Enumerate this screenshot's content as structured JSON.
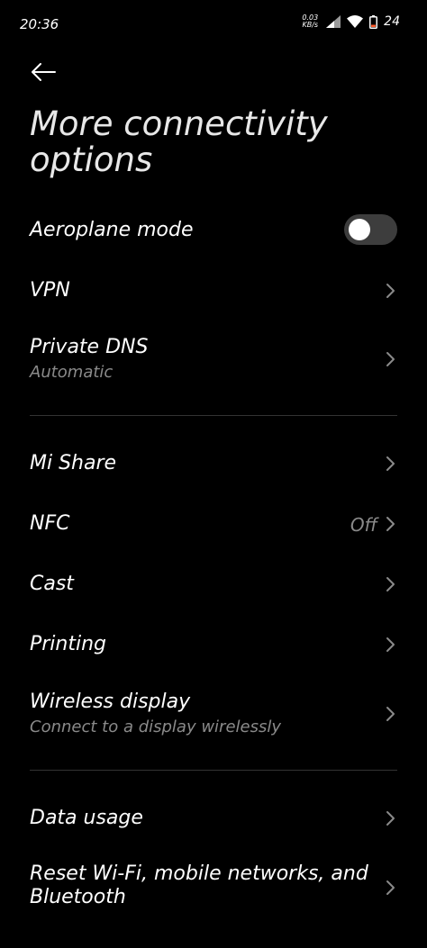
{
  "status_bar": {
    "time": "20:36",
    "net_speed_value": "0.03",
    "net_speed_unit": "KB/s",
    "battery_level": "24",
    "battery_color": "#ff5a2a",
    "icons": [
      "signal-icon",
      "wifi-icon",
      "battery-icon"
    ]
  },
  "header": {
    "back_icon": "arrow-left-icon",
    "title": "More connectivity options"
  },
  "settings": {
    "aeroplane_mode": {
      "label": "Aeroplane mode",
      "toggle_on": false
    },
    "vpn": {
      "label": "VPN"
    },
    "private_dns": {
      "label": "Private DNS",
      "sublabel": "Automatic"
    },
    "mi_share": {
      "label": "Mi Share"
    },
    "nfc": {
      "label": "NFC",
      "value": "Off"
    },
    "cast": {
      "label": "Cast"
    },
    "printing": {
      "label": "Printing"
    },
    "wireless_display": {
      "label": "Wireless display",
      "sublabel": "Connect to a display wirelessly"
    },
    "data_usage": {
      "label": "Data usage"
    },
    "reset_network": {
      "label_line1": "Reset Wi-Fi, mobile networks, and",
      "label_line2": "Bluetooth"
    }
  },
  "colors": {
    "background": "#000000",
    "primary_text": "#ffffff",
    "secondary_text": "#8a8a8a",
    "divider": "#333333",
    "toggle_track_off": "#3d3d3d"
  }
}
